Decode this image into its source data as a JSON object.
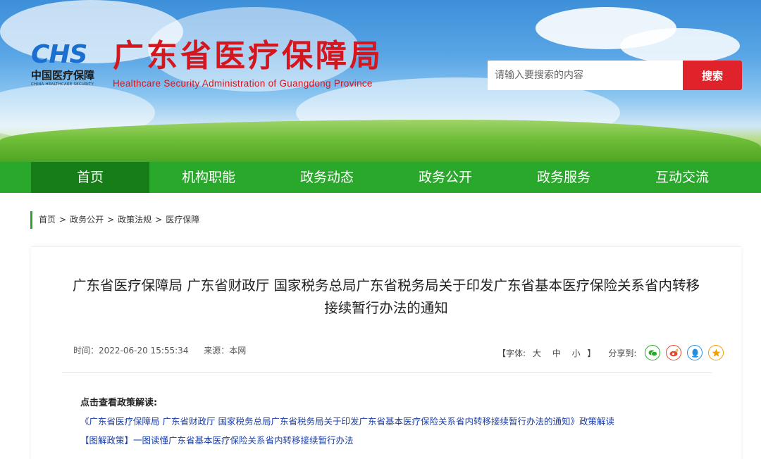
{
  "header": {
    "logo_mark": "CHS",
    "logo_cn": "中国医疗保障",
    "logo_en": "CHINA HEALTHCARE SECURITY",
    "site_title": "广东省医疗保障局",
    "site_subtitle": "Healthcare Security Administration of Guangdong Province",
    "search_placeholder": "请输入要搜索的内容",
    "search_button": "搜索"
  },
  "nav": {
    "items": [
      {
        "label": "首页"
      },
      {
        "label": "机构职能"
      },
      {
        "label": "政务动态"
      },
      {
        "label": "政务公开"
      },
      {
        "label": "政务服务"
      },
      {
        "label": "互动交流"
      }
    ]
  },
  "breadcrumb": {
    "items": [
      "首页",
      "政务公开",
      "政策法规",
      "医疗保障"
    ],
    "separator": ">"
  },
  "article": {
    "title_line1": "广东省医疗保障局 广东省财政厅 国家税务总局广东省税务局关于印发广东省基本医疗保险关系省内转移",
    "title_line2": "接续暂行办法的通知",
    "time": "时间：2022-06-20 15:55:34",
    "source": "来源：本网",
    "font_label": "【字体:",
    "font_large": "大",
    "font_medium": "中",
    "font_small": "小",
    "font_close": "】",
    "share_label": "分享到:",
    "share_icons": [
      "wechat-icon",
      "weibo-icon",
      "qq-icon",
      "qzone-icon"
    ],
    "interp_heading": "点击查看政策解读:",
    "interp_link1": "《广东省医疗保障局 广东省财政厅 国家税务总局广东省税务局关于印发广东省基本医疗保险关系省内转移接续暂行办法的通知》政策解读",
    "interp_link2": "【图解政策】一图读懂广东省基本医疗保险关系省内转移接续暂行办法"
  },
  "colors": {
    "brand_red": "#d4161f",
    "nav_green": "#2aa82b",
    "nav_active": "#167d18",
    "link_blue": "#1a3ea8"
  }
}
